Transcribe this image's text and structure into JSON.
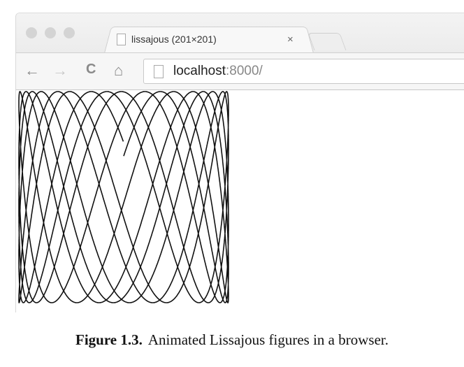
{
  "browser": {
    "tab": {
      "title": "lissajous (201×201)",
      "close_icon": "×"
    },
    "toolbar": {
      "back": "←",
      "forward": "→",
      "reload": "C",
      "home": "⌂"
    },
    "address": {
      "host": "localhost",
      "rest": ":8000/"
    }
  },
  "caption": {
    "label": "Figure 1.3.",
    "text": "Animated Lissajous figures in a browser."
  }
}
